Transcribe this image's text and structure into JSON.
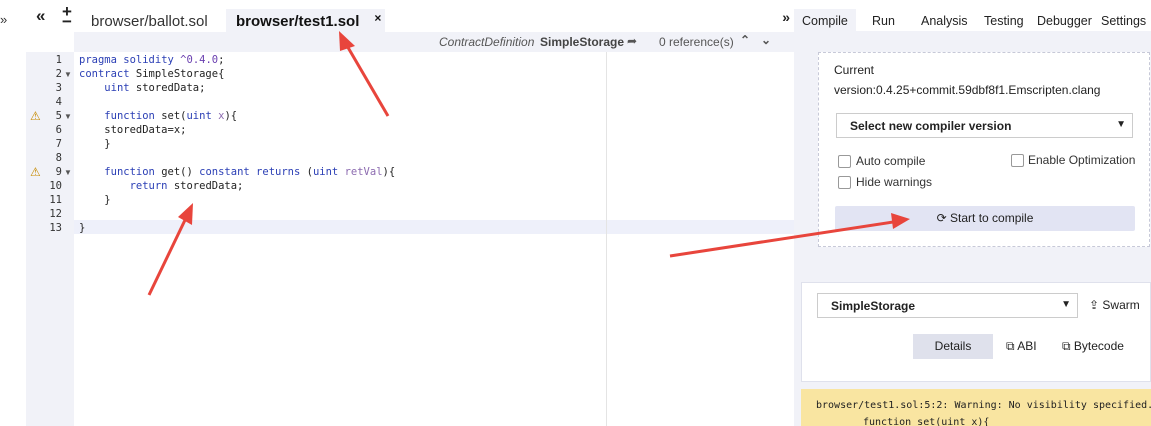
{
  "left_toggle": "»",
  "tabs": {
    "collapse_label": "«",
    "plus_label": "+",
    "minus_label": "−",
    "items": [
      {
        "label": "browser/ballot.sol",
        "active": false
      },
      {
        "label": "browser/test1.sol",
        "active": true,
        "close": "×"
      }
    ],
    "expand_label": "»"
  },
  "context": {
    "definition_label": "ContractDefinition",
    "name": "SimpleStorage",
    "jump_icon": "share-arrow-icon",
    "references": "0 reference(s)",
    "up": "︿",
    "down": "﹀"
  },
  "editor": {
    "line_numbers": [
      "1",
      "2",
      "3",
      "4",
      "5",
      "6",
      "7",
      "8",
      "9",
      "10",
      "11",
      "12",
      "13"
    ],
    "fold_markers": [
      "2",
      "5",
      "9"
    ],
    "warning_lines": [
      "5",
      "9"
    ],
    "lines": [
      "pragma solidity ^0.4.0;",
      "contract SimpleStorage{",
      "    uint storedData;",
      "",
      "    function set(uint x){",
      "    storedData=x;",
      "    }",
      "",
      "    function get() constant returns (uint retVal){",
      "        return storedData;",
      "    }",
      "",
      "}"
    ]
  },
  "right_panel": {
    "tabs": [
      "Compile",
      "Run",
      "Analysis",
      "Testing",
      "Debugger",
      "Settings"
    ],
    "active_tab": "Compile",
    "current_label": "Current",
    "current_version": "version:0.4.25+commit.59dbf8f1.Emscripten.clang",
    "select_version_label": "Select new compiler version",
    "auto_compile_label": "Auto compile",
    "enable_optimization_label": "Enable Optimization",
    "hide_warnings_label": "Hide warnings",
    "compile_button_label": "Start to compile",
    "contract_select": "SimpleStorage",
    "swarm_label": "Swarm",
    "details_label": "Details",
    "abi_label": "ABI",
    "bytecode_label": "Bytecode",
    "warning_line1": "browser/test1.sol:5:2: Warning: No visibility specified.",
    "warning_line2": "function set(uint x){"
  },
  "colors": {
    "panel_bg": "#f1f2f8",
    "keyword": "#2b3fb5",
    "warning_bg": "#f9e5a1",
    "annotation": "#e8453c"
  }
}
